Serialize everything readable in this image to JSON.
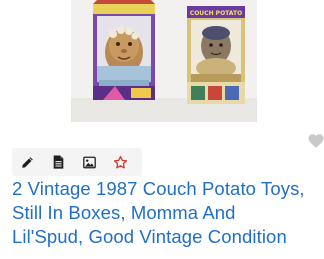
{
  "listing": {
    "title": "2 Vintage 1987 Couch Potato Toys, Still In Boxes, Momma And Lil'Spud, Good Vintage Condition",
    "photo": {
      "box_label_right": "COUCH POTATO"
    }
  },
  "toolbar": {
    "icons": [
      "pencil-icon",
      "document-icon",
      "image-icon",
      "star-icon"
    ]
  },
  "favorite": {
    "icon": "heart-icon"
  },
  "colors": {
    "title": "#1f6fc9",
    "star": "#d0342c",
    "toolbar_bg": "#f4f4f4",
    "heart": "#c9c9c9"
  }
}
